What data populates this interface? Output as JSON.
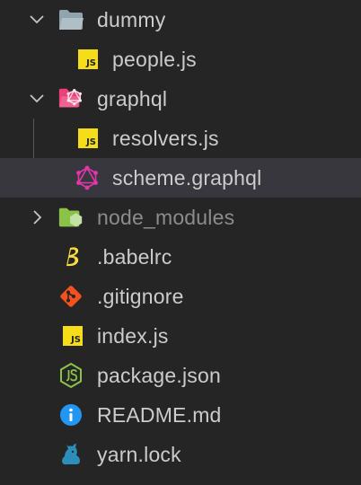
{
  "explorer": {
    "items": [
      {
        "label": "dummy",
        "icon": "folder-open-icon",
        "expanded": true,
        "depth": 0
      },
      {
        "label": "people.js",
        "icon": "javascript-icon",
        "depth": 1
      },
      {
        "label": "graphql",
        "icon": "graphql-folder-open-icon",
        "expanded": true,
        "depth": 0
      },
      {
        "label": "resolvers.js",
        "icon": "javascript-icon",
        "depth": 1
      },
      {
        "label": "scheme.graphql",
        "icon": "graphql-icon",
        "depth": 1,
        "selected": true
      },
      {
        "label": "node_modules",
        "icon": "node-folder-icon",
        "expanded": false,
        "depth": 0,
        "dimmed": true
      },
      {
        "label": ".babelrc",
        "icon": "babel-icon",
        "depth": 0
      },
      {
        "label": ".gitignore",
        "icon": "git-icon",
        "depth": 0
      },
      {
        "label": "index.js",
        "icon": "javascript-icon",
        "depth": 0
      },
      {
        "label": "package.json",
        "icon": "nodejs-icon",
        "depth": 0
      },
      {
        "label": "README.md",
        "icon": "info-icon",
        "depth": 0
      },
      {
        "label": "yarn.lock",
        "icon": "yarn-icon",
        "depth": 0
      }
    ]
  },
  "colors": {
    "background": "#252526",
    "selected_row": "#37373d",
    "text": "#cccccc",
    "dimmed_text": "#8c8c8c",
    "javascript": "#f5de19",
    "graphql": "#e535ab",
    "node_green": "#8bc34a",
    "git": "#f4511e",
    "info": "#2196f3",
    "yarn": "#2c8ebb",
    "babel": "#f9dc3e"
  },
  "badges": {
    "js": "JS"
  }
}
